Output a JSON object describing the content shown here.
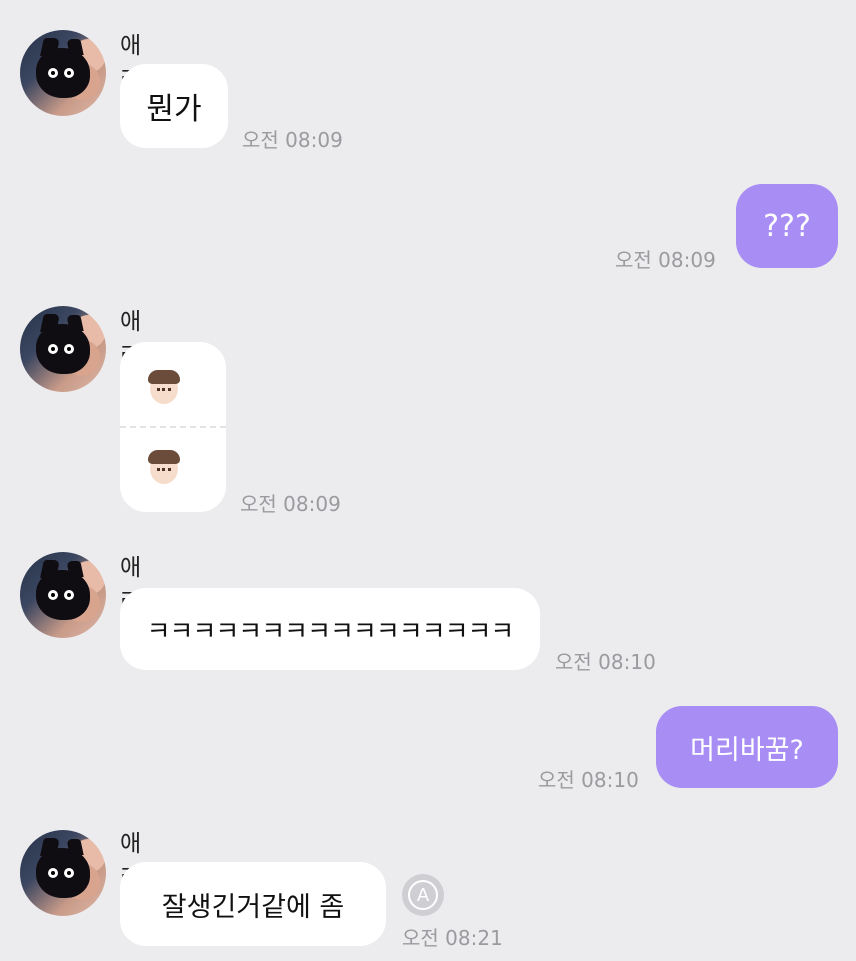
{
  "messages": [
    {
      "type": "in",
      "sender": "애리",
      "text": "뭔가",
      "time": "오전 08:09"
    },
    {
      "type": "out",
      "text": "???",
      "time": "오전 08:09"
    },
    {
      "type": "in-emoji",
      "sender": "애리",
      "emojis": [
        "person-emoji",
        "person-emoji"
      ],
      "time": "오전 08:09"
    },
    {
      "type": "in",
      "sender": "애리",
      "text": "ㅋㅋㅋㅋㅋㅋㅋㅋㅋㅋㅋㅋㅋㅋㅋㅋ",
      "time": "오전 08:10"
    },
    {
      "type": "out",
      "text": "머리바꿈?",
      "time": "오전 08:10"
    },
    {
      "type": "in",
      "sender": "애리",
      "text": "잘생긴거같에 좀",
      "time": "오전 08:21",
      "translate_icon": "A"
    }
  ],
  "colors": {
    "background": "#ececee",
    "incoming_bubble": "#ffffff",
    "outgoing_bubble": "#a88ef4",
    "timestamp": "#9a9a9f"
  }
}
